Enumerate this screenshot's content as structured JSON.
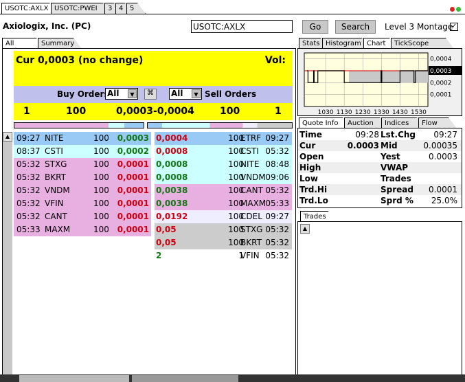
{
  "window_tabs": [
    "USOTC:AXLX",
    "USOTC:PWEI",
    "3",
    "4",
    "5"
  ],
  "company": "Axiologix, Inc. (PC)",
  "symbol_input": "USOTC:AXLX",
  "go_label": "Go",
  "search_label": "Search",
  "level3_label": "Level 3 Montage",
  "level3_checked": true,
  "left_tabs": [
    "All orders",
    "Summary"
  ],
  "cur_text": "Cur 0,0003 (no change)",
  "vol_label": "Vol:",
  "buy_orders_label": "Buy Orders",
  "sell_orders_label": "Sell Orders",
  "buy_filter": "All",
  "sell_filter": "All",
  "summary": {
    "buy_count": "1",
    "buy_size": "100",
    "spread": "0,0003-0,0004",
    "sell_size": "100",
    "sell_count": "1"
  },
  "colors": {
    "yellow": "#ffff00",
    "blue_bar": "#c0c0ec",
    "level1": "#99c9f5",
    "level2": "#ccffff",
    "level3": "#e8b0e0",
    "level4": "#eeeeff",
    "level5": "#cccccc"
  },
  "buy_rows": [
    {
      "time": "09:27",
      "mm": "NITE",
      "size": "100",
      "price": "0,0003",
      "pc": "g",
      "bg": "#99c9f5"
    },
    {
      "time": "08:37",
      "mm": "CSTI",
      "size": "100",
      "price": "0,0002",
      "pc": "g",
      "bg": "#ccffff"
    },
    {
      "time": "05:32",
      "mm": "STXG",
      "size": "100",
      "price": "0,0001",
      "pc": "r",
      "bg": "#e8b0e0"
    },
    {
      "time": "05:32",
      "mm": "BKRT",
      "size": "100",
      "price": "0,0001",
      "pc": "r",
      "bg": "#e8b0e0"
    },
    {
      "time": "05:32",
      "mm": "VNDM",
      "size": "100",
      "price": "0,0001",
      "pc": "r",
      "bg": "#e8b0e0"
    },
    {
      "time": "05:32",
      "mm": "VFIN",
      "size": "100",
      "price": "0,0001",
      "pc": "r",
      "bg": "#e8b0e0"
    },
    {
      "time": "05:32",
      "mm": "CANT",
      "size": "100",
      "price": "0,0001",
      "pc": "r",
      "bg": "#e8b0e0"
    },
    {
      "time": "05:33",
      "mm": "MAXM",
      "size": "100",
      "price": "0,0001",
      "pc": "r",
      "bg": "#e8b0e0"
    }
  ],
  "sell_rows": [
    {
      "price": "0,0004",
      "pc": "r",
      "size": "100",
      "mm": "ETRF",
      "time": "09:27",
      "bg": "#99c9f5"
    },
    {
      "price": "0,0008",
      "pc": "r",
      "size": "100",
      "mm": "CSTI",
      "time": "05:32",
      "bg": "#ccffff"
    },
    {
      "price": "0,0008",
      "pc": "g",
      "size": "100",
      "mm": "NITE",
      "time": "08:48",
      "bg": "#ccffff"
    },
    {
      "price": "0,0008",
      "pc": "g",
      "size": "100",
      "mm": "VNDM",
      "time": "09:06",
      "bg": "#ccffff"
    },
    {
      "price": "0,0038",
      "pc": "g",
      "size": "100",
      "mm": "CANT",
      "time": "05:32",
      "bg": "#e8b0e0"
    },
    {
      "price": "0,0038",
      "pc": "g",
      "size": "100",
      "mm": "MAXM",
      "time": "05:33",
      "bg": "#e8b0e0"
    },
    {
      "price": "0,0192",
      "pc": "r",
      "size": "100",
      "mm": "CDEL",
      "time": "09:27",
      "bg": "#eeeeff"
    },
    {
      "price": "0,05",
      "pc": "r",
      "size": "100",
      "mm": "STXG",
      "time": "05:32",
      "bg": "#cccccc"
    },
    {
      "price": "0,05",
      "pc": "r",
      "size": "100",
      "mm": "BKRT",
      "time": "05:32",
      "bg": "#cccccc"
    },
    {
      "price": "2",
      "pc": "g",
      "size": "1",
      "mm": "VFIN",
      "time": "05:32",
      "bg": "#ffffff"
    }
  ],
  "right_tabs": [
    "Stats",
    "Histogram",
    "Chart",
    "TickScope"
  ],
  "chart_data": {
    "type": "line",
    "x_ticks": [
      "1030",
      "1130",
      "1230",
      "1330",
      "1430",
      "1530"
    ],
    "y_ticks": [
      "0,0004",
      "0,0003",
      "0,0002",
      "0,0001"
    ],
    "current_label": "0,0003",
    "ylim": [
      0,
      0.00045
    ],
    "series": [
      {
        "color": "#000000",
        "x": [
          9.5,
          9.55,
          9.85,
          9.88,
          10.08,
          11.5,
          13.48,
          13.52,
          14.5,
          15.25,
          15.33,
          16.0
        ],
        "values": [
          0.0003,
          0.0002,
          0.0003,
          0.0002,
          0.0003,
          0.0002,
          0.0003,
          0.0002,
          0.0003,
          0.0002,
          0.0003,
          0.0003
        ]
      }
    ],
    "reference_line": {
      "value": 0.0003,
      "color": "#dd2222"
    },
    "spread_band": {
      "from": 11.75,
      "to": 16.0,
      "low": 0.0002,
      "high": 0.0003,
      "color": "#c8c8c8"
    }
  },
  "quote_tabs": [
    "Quote Info",
    "Auction",
    "Indices",
    "Flow"
  ],
  "quote": [
    {
      "l": "Time",
      "v": "09:28",
      "l2": "Lst.Chg",
      "v2": "09:27"
    },
    {
      "l": "Cur",
      "v": "0.0003",
      "l2": "Mid",
      "v2": "0.00035"
    },
    {
      "l": "Open",
      "v": "",
      "l2": "Yest",
      "v2": "0.0003"
    },
    {
      "l": "High",
      "v": "",
      "l2": "VWAP",
      "v2": ""
    },
    {
      "l": "Low",
      "v": "",
      "l2": "Trades",
      "v2": ""
    },
    {
      "l": "Trd.Hi",
      "v": "",
      "l2": "Spread",
      "v2": "0.0001"
    },
    {
      "l": "Trd.Lo",
      "v": "",
      "l2": "Sprd %",
      "v2": "25.0%"
    }
  ],
  "trades_tab": "Trades"
}
